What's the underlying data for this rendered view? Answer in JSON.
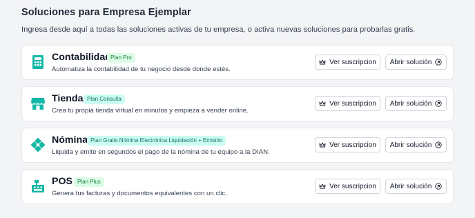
{
  "header": {
    "title": "Soluciones para Empresa Ejemplar",
    "subtitle": "Ingresa desde aquí a todas las soluciones activas de tu empresa, o activa nuevas soluciones para probarlas gratis."
  },
  "cards": [
    {
      "name": "Contabilidad",
      "badge": "Plan Pro",
      "description": "Automatiza la contabilidad de tu negocio desde donde estés.",
      "icon": "calculator-icon",
      "subscription_label": "Ver suscripcion",
      "open_label": "Abrir solución"
    },
    {
      "name": "Tienda",
      "badge": "Plan Consulta",
      "description": "Crea tu propia tienda virtual en minutos y empieza a vender online.",
      "icon": "store-icon",
      "subscription_label": "Ver suscripcion",
      "open_label": "Abrir solución"
    },
    {
      "name": "Nómina",
      "badge": "Plan Gratis Nómina Electrónica Liquidación + Emisión",
      "description": "Liquida y emite en segundos el pago de la nómina de tu equipo a la DIAN.",
      "icon": "payroll-diamond-icon",
      "subscription_label": "Ver suscripcion",
      "open_label": "Abrir solución"
    },
    {
      "name": "POS",
      "badge": "Plan Plus",
      "description": "Genera tus facturas y documentos equivalentes con un clic.",
      "icon": "cash-register-icon",
      "subscription_label": "Ver suscripcion",
      "open_label": "Abrir solución"
    }
  ],
  "colors": {
    "brand_teal": "#14b8a6",
    "badge_green_bg": "#dcfce7",
    "badge_teal_bg": "#ccfbf1"
  }
}
